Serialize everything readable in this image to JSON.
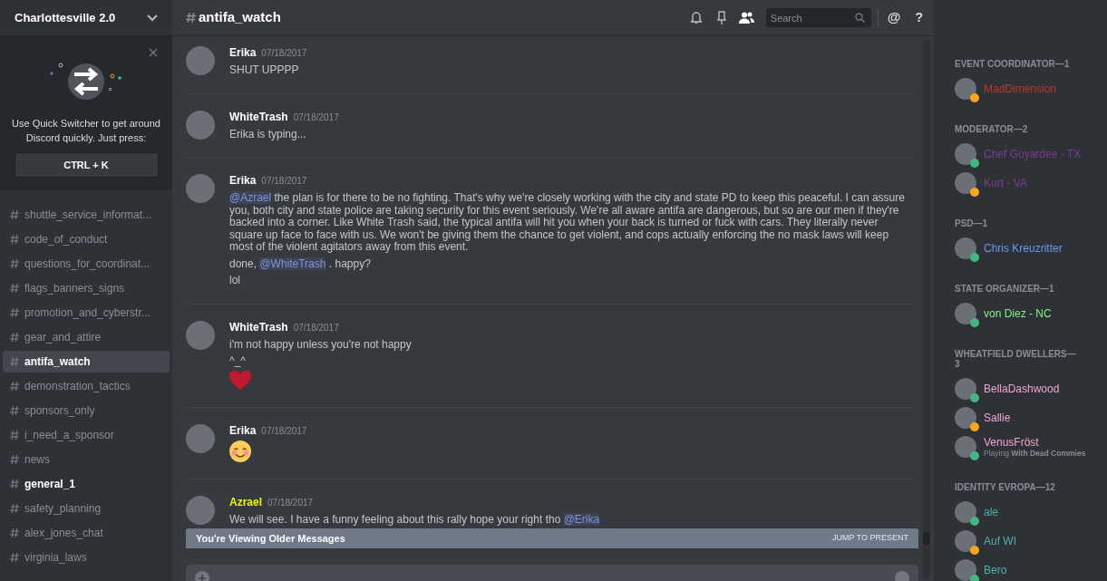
{
  "server": {
    "name": "Charlottesville 2.0"
  },
  "quick_switcher": {
    "text": "Use Quick Switcher to get around Discord quickly. Just press:",
    "shortcut": "CTRL + K"
  },
  "channels": [
    {
      "name": "shuttle_service_informat...",
      "selected": false,
      "unread": false
    },
    {
      "name": "code_of_conduct",
      "selected": false,
      "unread": false
    },
    {
      "name": "questions_for_coordinat...",
      "selected": false,
      "unread": false
    },
    {
      "name": "flags_banners_signs",
      "selected": false,
      "unread": false
    },
    {
      "name": "promotion_and_cyberstr...",
      "selected": false,
      "unread": false
    },
    {
      "name": "gear_and_attire",
      "selected": false,
      "unread": false
    },
    {
      "name": "antifa_watch",
      "selected": true,
      "unread": false
    },
    {
      "name": "demonstration_tactics",
      "selected": false,
      "unread": false
    },
    {
      "name": "sponsors_only",
      "selected": false,
      "unread": false
    },
    {
      "name": "i_need_a_sponsor",
      "selected": false,
      "unread": false
    },
    {
      "name": "news",
      "selected": false,
      "unread": false
    },
    {
      "name": "general_1",
      "selected": false,
      "unread": true
    },
    {
      "name": "safety_planning",
      "selected": false,
      "unread": false
    },
    {
      "name": "alex_jones_chat",
      "selected": false,
      "unread": false
    },
    {
      "name": "virginia_laws",
      "selected": false,
      "unread": false
    }
  ],
  "header": {
    "channel": "antifa_watch",
    "search_placeholder": "Search",
    "members_on": true,
    "at": "@",
    "help": "?"
  },
  "messages": [
    {
      "author": "Erika",
      "color": "#ffffff",
      "time": "07/18/2017",
      "lines": [
        {
          "kind": "text",
          "parts": [
            {
              "kind": "plain",
              "text": "SHUT UPPPP"
            }
          ]
        }
      ]
    },
    {
      "author": "WhiteTrash",
      "color": "#ffffff",
      "time": "07/18/2017",
      "lines": [
        {
          "kind": "text",
          "parts": [
            {
              "kind": "plain",
              "text": "Erika is typing..."
            }
          ]
        }
      ]
    },
    {
      "author": "Erika",
      "color": "#ffffff",
      "time": "07/18/2017",
      "lines": [
        {
          "kind": "text",
          "parts": [
            {
              "kind": "mention",
              "text": "@Azrael"
            },
            {
              "kind": "plain",
              "text": " the plan is for there to be no fighting. That's why we're closely working with the city and state PD to keep this peaceful. I can assure you, both city and state police are taking security for this event seriously. We're all aware antifa are dangerous, but so are our men if they're backed into a corner. Like White Trash said, the typical antifa will hit you when your back is turned or fuck with cars. They literally never square up face to face with us. We won't be giving them the chance to get violent, and cops actually enforcing the no mask laws will keep most of the violent agitators away from this event."
            }
          ]
        },
        {
          "kind": "text",
          "parts": [
            {
              "kind": "plain",
              "text": "done, "
            },
            {
              "kind": "mention",
              "text": "@WhiteTrash"
            },
            {
              "kind": "plain",
              "text": " . happy?"
            }
          ]
        },
        {
          "kind": "text",
          "parts": [
            {
              "kind": "plain",
              "text": "lol"
            }
          ]
        }
      ]
    },
    {
      "author": "WhiteTrash",
      "color": "#ffffff",
      "time": "07/18/2017",
      "lines": [
        {
          "kind": "text",
          "parts": [
            {
              "kind": "plain",
              "text": "i'm not happy unless you're not happy"
            }
          ]
        },
        {
          "kind": "text",
          "parts": [
            {
              "kind": "plain",
              "text": "^_^"
            }
          ]
        },
        {
          "kind": "heart"
        }
      ]
    },
    {
      "author": "Erika",
      "color": "#ffffff",
      "time": "07/18/2017",
      "lines": [
        {
          "kind": "smiley"
        }
      ]
    },
    {
      "author": "Azrael",
      "color": "#f1f40f",
      "time": "07/18/2017",
      "lines": [
        {
          "kind": "text",
          "parts": [
            {
              "kind": "plain",
              "text": "We will see. I have a funny feeling about this rally hope your right tho  "
            },
            {
              "kind": "mention",
              "text": "@Erika"
            }
          ]
        }
      ]
    }
  ],
  "older_bar": {
    "text": "You're Viewing Older Messages",
    "action": "JUMP TO PRESENT"
  },
  "member_groups": [
    {
      "title": "EVENT COORDINATOR—1",
      "members": [
        {
          "name": "MadDimension",
          "color": "#b8392c",
          "status": {
            "color": "#faa61a"
          }
        }
      ]
    },
    {
      "title": "MODERATOR—2",
      "members": [
        {
          "name": "Chef Goyardee - TX",
          "color": "#7a3d96",
          "status": {
            "color": "#43b581"
          }
        },
        {
          "name": "Kurt - VA",
          "color": "#7a3d96",
          "status": {
            "color": "#faa61a"
          }
        }
      ]
    },
    {
      "title": "PSD—1",
      "members": [
        {
          "name": "Chris Kreuzritter",
          "color": "#6f96ee",
          "status": {
            "color": "#43b581"
          }
        }
      ]
    },
    {
      "title": "STATE ORGANIZER—1",
      "members": [
        {
          "name": "von Diez - NC",
          "color": "#80f58a",
          "status": {
            "color": "#43b581"
          }
        }
      ]
    },
    {
      "title": "WHEATFIELD DWELLERS—3",
      "members": [
        {
          "name": "BellaDashwood",
          "color": "#f0a5d2",
          "status": {
            "color": "#43b581"
          }
        },
        {
          "name": "Sallie",
          "color": "#f0a5d2",
          "status": {
            "color": "#faa61a"
          }
        },
        {
          "name": "VenusFröst",
          "color": "#f0a5d2",
          "status": {
            "color": "#43b581"
          },
          "activity": "Playing **With Dead Commies**"
        }
      ]
    },
    {
      "title": "IDENTITY EVROPA—12",
      "members": [
        {
          "name": "ale",
          "color": "#4fb1ad",
          "status": {
            "color": "#43b581"
          }
        },
        {
          "name": "Auf WI",
          "color": "#4fb1ad",
          "status": {
            "color": "#faa61a"
          }
        },
        {
          "name": "Bero",
          "color": "#4fb1ad",
          "status": {
            "color": "#43b581"
          }
        }
      ]
    }
  ]
}
